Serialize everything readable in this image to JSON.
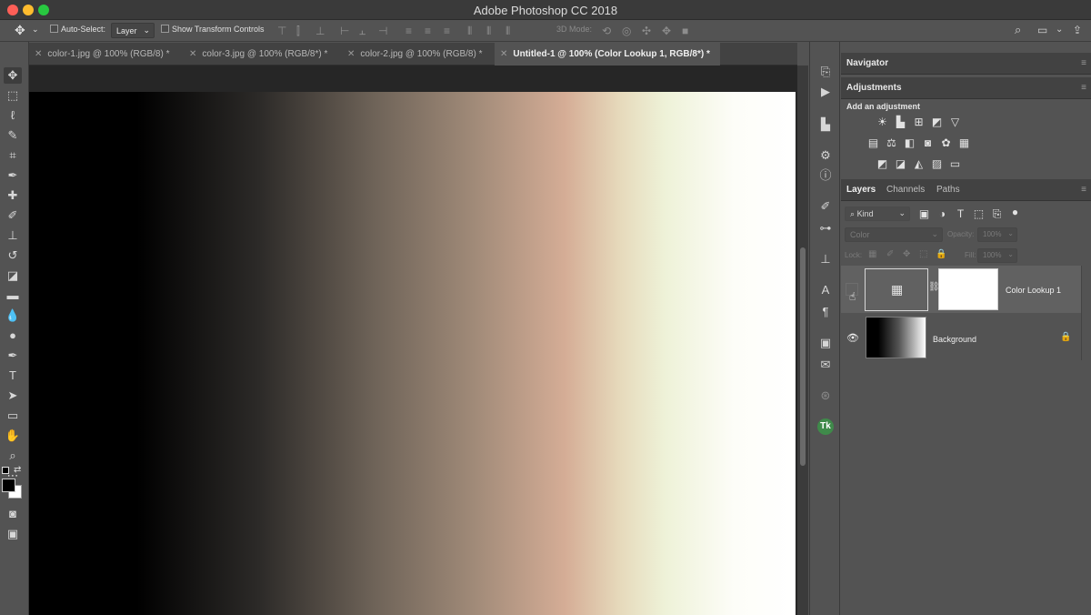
{
  "window": {
    "title": "Adobe Photoshop CC 2018",
    "colors": {
      "close": "#fe5f57",
      "minimize": "#febc2e",
      "zoom": "#28c840"
    }
  },
  "options_bar": {
    "auto_select_label": "Auto-Select:",
    "auto_select_value": "Layer",
    "show_transform_label": "Show Transform Controls",
    "mode_3d_label": "3D Mode:"
  },
  "tabs": [
    {
      "label": "color-1.jpg @ 100% (RGB/8) *",
      "active": false
    },
    {
      "label": "color-3.jpg @ 100% (RGB/8*) *",
      "active": false
    },
    {
      "label": "color-2.jpg @ 100% (RGB/8) *",
      "active": false
    },
    {
      "label": "Untitled-1 @ 100% (Color Lookup 1, RGB/8*) *",
      "active": true
    }
  ],
  "navigator": {
    "title": "Navigator"
  },
  "adjustments": {
    "title": "Adjustments",
    "subtitle": "Add an adjustment"
  },
  "layers_panel": {
    "tabs": [
      "Layers",
      "Channels",
      "Paths"
    ],
    "filter_value": "Kind",
    "blend_mode": "Color",
    "opacity_label": "Opacity:",
    "opacity_value": "100%",
    "lock_label": "Lock:",
    "fill_label": "Fill:",
    "fill_value": "100%",
    "layers": [
      {
        "name": "Color Lookup 1",
        "visible": false,
        "selected": true
      },
      {
        "name": "Background",
        "visible": true,
        "locked": true
      }
    ]
  }
}
